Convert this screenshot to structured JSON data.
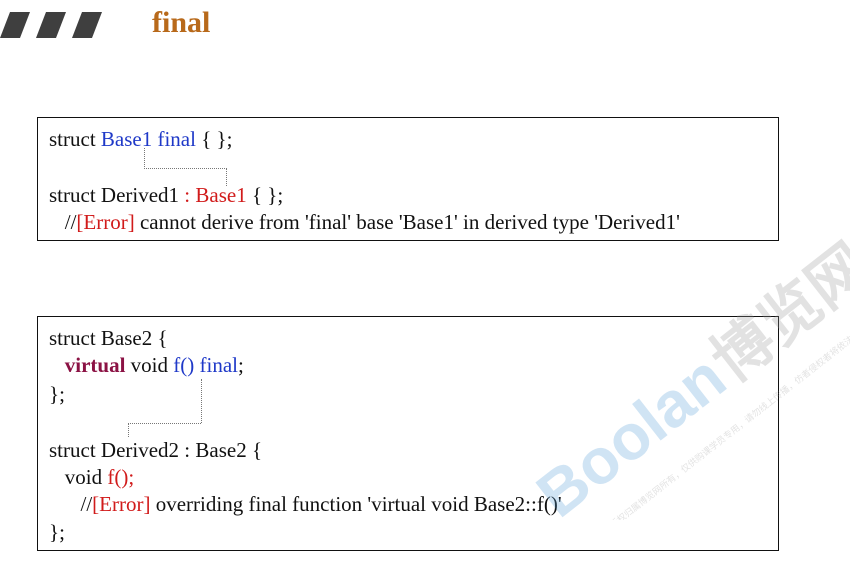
{
  "header": {
    "title": "final"
  },
  "colors": {
    "title": "#b8691a",
    "keyword_blue": "#1f39c8",
    "error_red": "#d11b1b",
    "virtual_kw": "#8b1244",
    "bars": "#3f3f3f"
  },
  "example1": {
    "l1": {
      "a": "struct ",
      "b": "Base1 final",
      "c": " { };"
    },
    "l2": {
      "a": "struct Derived1 ",
      "b": ": Base1",
      "c": " { };"
    },
    "l3": {
      "a": "   //",
      "b": "[Error]",
      "c": " cannot derive from 'final' base 'Base1' in derived type 'Derived1'"
    }
  },
  "example2": {
    "l1": "struct Base2 {",
    "l2": {
      "indent": "   ",
      "kw": "virtual",
      "a": " void ",
      "b": "f() final",
      "c": ";"
    },
    "l3": "};",
    "l4": "struct Derived2 : Base2 {",
    "l5": {
      "a": "   void ",
      "b": "f();"
    },
    "l6": {
      "a": "      //",
      "b": "[Error]",
      "c": " overriding final function 'virtual void Base2::f()'"
    },
    "l7": "};"
  },
  "watermark": {
    "brand": "Boolan",
    "cn": "博览网",
    "note": "本课程版权归属博览网所有，仅供购课学员专用，请勿线上传播，仿者侵权者将依法追责与制裁权。"
  }
}
